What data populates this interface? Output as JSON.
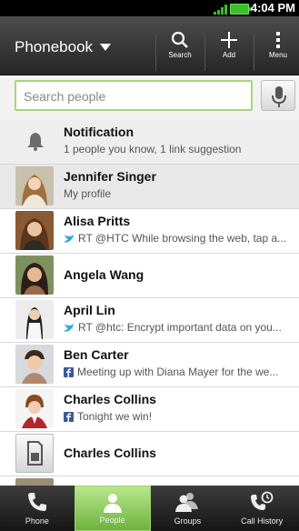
{
  "status": {
    "time": "4:04 PM"
  },
  "header": {
    "title": "Phonebook",
    "actions": [
      {
        "label": "Search",
        "icon": "search-icon"
      },
      {
        "label": "Add",
        "icon": "plus-icon"
      },
      {
        "label": "Menu",
        "icon": "menu-icon"
      }
    ]
  },
  "search": {
    "placeholder": "Search people"
  },
  "contacts": [
    {
      "name": "Notification",
      "sub": "1 people you know, 1 link suggestion",
      "type": "notification"
    },
    {
      "name": "Jennifer Singer",
      "sub": "My profile",
      "type": "profile"
    },
    {
      "name": "Alisa Pritts",
      "sub": "RT @HTC While browsing the web, tap a...",
      "sub_icon": "twitter-icon"
    },
    {
      "name": "Angela Wang",
      "sub": ""
    },
    {
      "name": "April Lin",
      "sub": "RT @htc: Encrypt important data on you...",
      "sub_icon": "twitter-icon"
    },
    {
      "name": "Ben Carter",
      "sub": "Meeting up with Diana Mayer for the we...",
      "sub_icon": "facebook-icon"
    },
    {
      "name": "Charles Collins",
      "sub": "Tonight we win!",
      "sub_icon": "facebook-icon"
    },
    {
      "name": "Charles Collins",
      "sub": "",
      "avatar": "sim-card-icon"
    }
  ],
  "tabs": [
    {
      "label": "Phone",
      "icon": "phone-icon"
    },
    {
      "label": "People",
      "icon": "person-icon",
      "active": true
    },
    {
      "label": "Groups",
      "icon": "groups-icon"
    },
    {
      "label": "Call History",
      "icon": "call-history-icon"
    }
  ],
  "colors": {
    "accent": "#8ccf5a",
    "battery": "#3bbf2a",
    "twitter": "#2aa9e0",
    "facebook": "#3b5998"
  }
}
